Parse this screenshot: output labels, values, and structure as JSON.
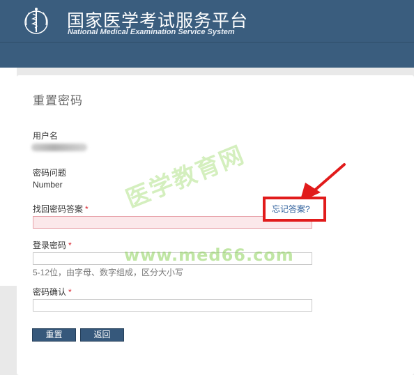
{
  "header": {
    "title_cn": "国家医学考试服务平台",
    "title_en": "National Medical Examination Service System",
    "logo_icon": "medical-caduceus-emblem-icon"
  },
  "form": {
    "page_title": "重置密码",
    "username_label": "用户名",
    "question_label": "密码问题",
    "question_value": "Number",
    "answer_label": "找回密码答案",
    "required_mark": "*",
    "login_password_label": "登录密码",
    "password_hint": "5-12位，由字母、数字组成，区分大小写",
    "confirm_label": "密码确认",
    "forgot_answer_link": "忘记答案?",
    "reset_button": "重置",
    "back_button": "返回"
  },
  "watermark": {
    "cn": "医学教育网",
    "url": "www.med66.com"
  },
  "colors": {
    "header_bg": "#3a5d7e",
    "highlight_red": "#e11b1b",
    "required_red": "#d9232d",
    "link_blue": "#2a5c9a",
    "button_bg": "#36587b",
    "error_field_bg": "#fbe8ea"
  }
}
